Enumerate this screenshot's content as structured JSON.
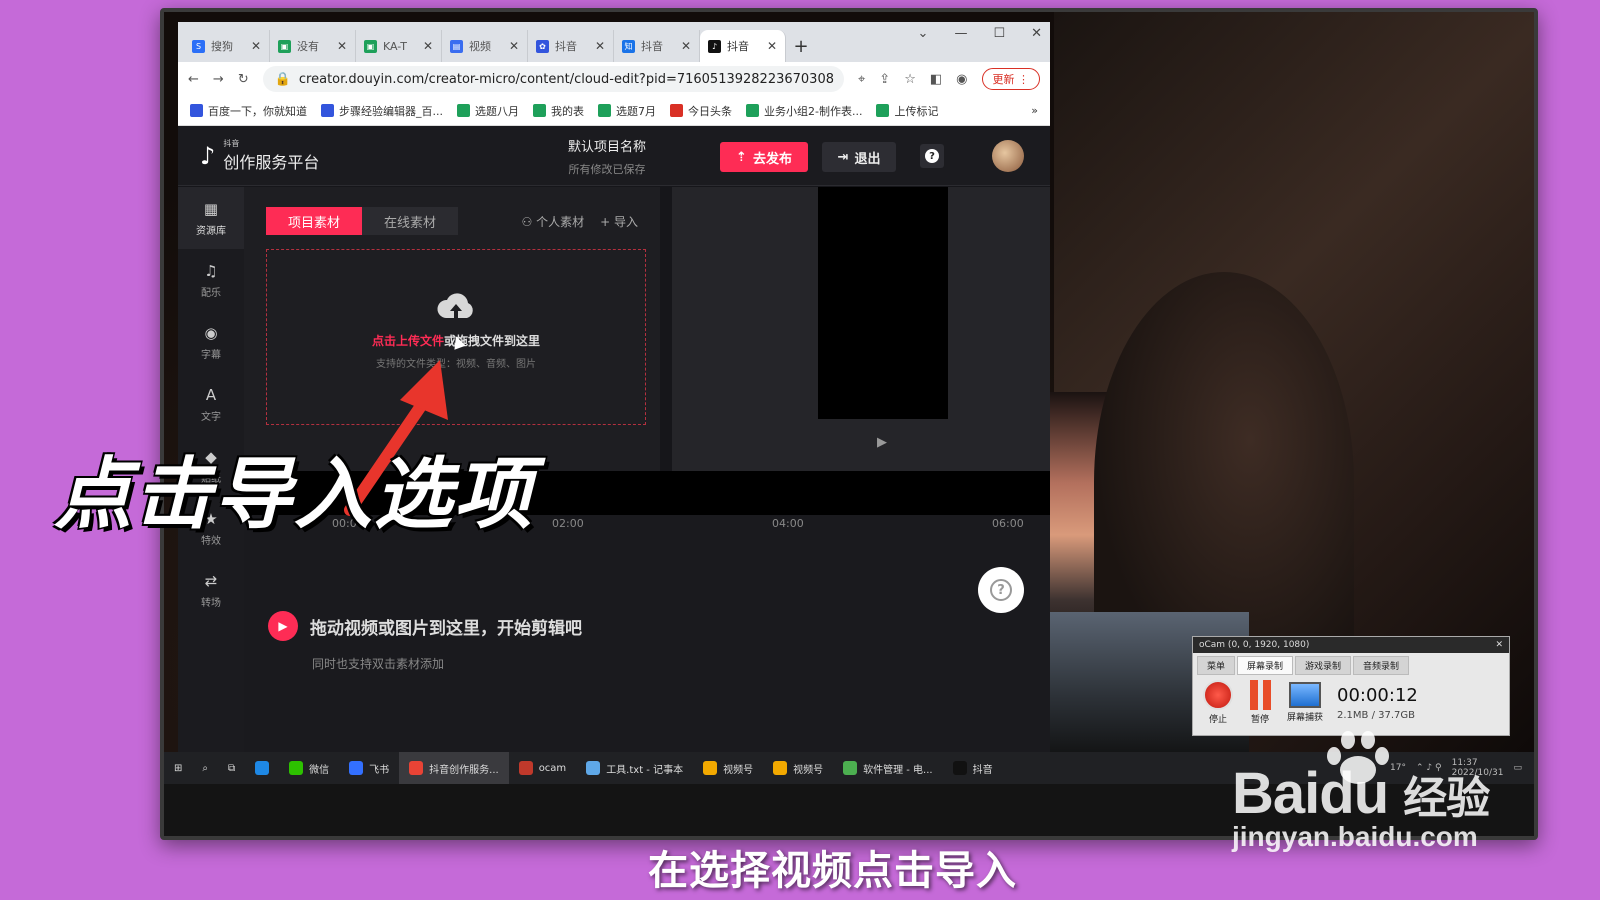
{
  "browser": {
    "tabs": [
      {
        "label": "搜狗",
        "fav_color": "#2b6ff7",
        "fav_text": "S"
      },
      {
        "label": "没有",
        "fav_color": "#1ea05a",
        "fav_text": "▣"
      },
      {
        "label": "KA-T",
        "fav_color": "#1ea05a",
        "fav_text": "▣"
      },
      {
        "label": "视频",
        "fav_color": "#3a6df0",
        "fav_text": "▤"
      },
      {
        "label": "抖音",
        "fav_color": "#3355dd",
        "fav_text": "✿"
      },
      {
        "label": "抖音",
        "fav_color": "#1a73e8",
        "fav_text": "知"
      },
      {
        "label": "抖音",
        "fav_color": "#111111",
        "fav_text": "♪",
        "active": true
      }
    ],
    "url": "creator.douyin.com/creator-micro/content/cloud-edit?pid=7160513928223670308",
    "update_label": "更新",
    "bookmarks": [
      "百度一下，你就知道",
      "步骤经验编辑器_百...",
      "选题八月",
      "我的表",
      "选题7月",
      "今日头条",
      "业务小组2-制作表...",
      "上传标记"
    ],
    "more_bookmarks": "»"
  },
  "app": {
    "logo_small": "抖音",
    "logo_title": "创作服务平台",
    "project_name": "默认项目名称",
    "saved_status": "所有修改已保存",
    "publish_label": "去发布",
    "logout_label": "退出",
    "help_label": "?",
    "sidenav": [
      {
        "label": "资源库",
        "icon": "grid-icon",
        "glyph": "▦"
      },
      {
        "label": "配乐",
        "icon": "music-icon",
        "glyph": "♫"
      },
      {
        "label": "字幕",
        "icon": "subtitle-icon",
        "glyph": "◉"
      },
      {
        "label": "文字",
        "icon": "text-icon",
        "glyph": "A"
      },
      {
        "label": "贴纸",
        "icon": "sticker-icon",
        "glyph": "◆"
      },
      {
        "label": "特效",
        "icon": "effects-icon",
        "glyph": "★"
      },
      {
        "label": "转场",
        "icon": "transition-icon",
        "glyph": "⇄"
      }
    ],
    "asset_tabs": [
      "项目素材",
      "在线素材"
    ],
    "personal_assets": "个人素材",
    "import_label": "导入",
    "drop_click": "点击上传文件",
    "drop_or": "或拖拽文件到这里",
    "drop_support": "支持的文件类型：视频、音频、图片",
    "ruler": [
      "00:00",
      "02:00",
      "04:00",
      "06:00"
    ],
    "timeline_hint": "拖动视频或图片到这里，开始剪辑吧",
    "timeline_sub": "同时也支持双击素材添加"
  },
  "ocam": {
    "title": "oCam (0, 0, 1920, 1080)",
    "tabs": [
      "菜单",
      "屏幕录制",
      "游戏录制",
      "音频录制"
    ],
    "stop": "停止",
    "pause": "暂停",
    "screen": "屏幕捕获",
    "timer": "00:00:12",
    "size": "2.1MB / 37.7GB"
  },
  "taskbar": {
    "items": [
      {
        "label": "微信",
        "color": "#2dc100"
      },
      {
        "label": "飞书",
        "color": "#3370ff"
      },
      {
        "label": "抖音创作服务...",
        "color": "#e94335",
        "active": true
      },
      {
        "label": "ocam",
        "color": "#c0392b"
      },
      {
        "label": "工具.txt - 记事本",
        "color": "#5fa8e8"
      },
      {
        "label": "视频号",
        "color": "#f2a900"
      },
      {
        "label": "视频号",
        "color": "#f2a900"
      },
      {
        "label": "软件管理 - 电...",
        "color": "#4caf50"
      },
      {
        "label": "抖音",
        "color": "#111111"
      }
    ],
    "temp": "17°",
    "time": "11:37",
    "date": "2022/10/31"
  },
  "overlay": {
    "caption": "点击导入选项",
    "subtitle": "在选择视频点击导入",
    "watermark_brand": "Bai",
    "watermark_du": "du",
    "watermark_jingyan": "经验",
    "watermark_domain": "jingyan.baidu.com"
  }
}
